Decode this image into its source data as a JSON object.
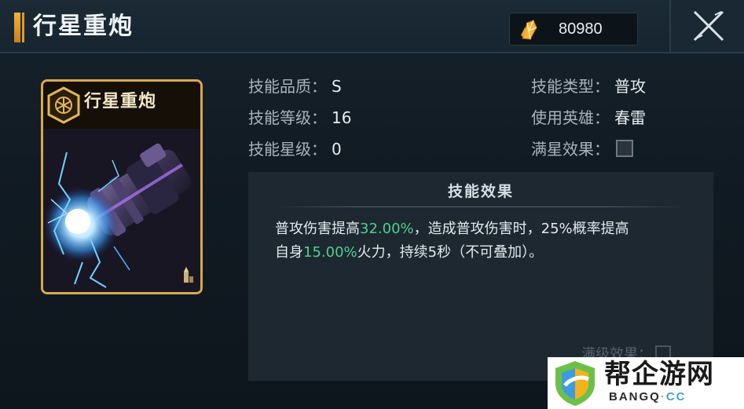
{
  "header": {
    "title": "行星重炮",
    "currency_value": "80980",
    "currency_icon": "crystal-icon",
    "close_icon": "close-icon"
  },
  "card": {
    "name": "行星重炮",
    "emblem_icon": "emblem-icon"
  },
  "info": {
    "quality_label": "技能品质：",
    "quality_value": "S",
    "level_label": "技能等级：",
    "level_value": "16",
    "star_label": "技能星级：",
    "star_value": "0",
    "type_label": "技能类型：",
    "type_value": "普攻",
    "hero_label": "使用英雄：",
    "hero_value": "春雷",
    "full_star_label": "满星效果："
  },
  "effect": {
    "title": "技能效果",
    "line1_a": "普攻伤害提高",
    "line1_hl": "32.00%",
    "line1_b": "，造成普攻伤害时，25%概率提高",
    "line2_a": "自身",
    "line2_hl": "15.00%",
    "line2_b": "火力，持续5秒（不可叠加）。",
    "faded_label": "满级效果："
  },
  "watermark": {
    "text": "帮企游网",
    "sub_a": "BANGQ",
    "sub_dot": "·",
    "sub_b": "CC"
  },
  "colors": {
    "accent_gold": "#d8a94a",
    "highlight_green": "#4fd18f"
  }
}
